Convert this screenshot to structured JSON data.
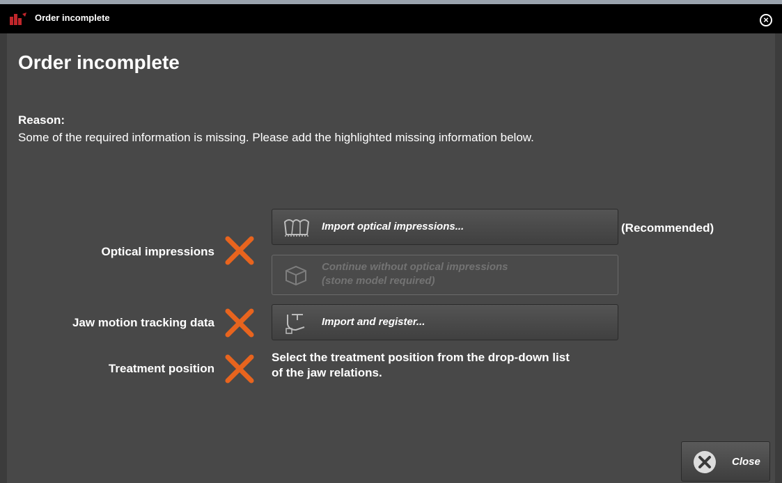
{
  "window": {
    "title": "Order incomplete",
    "close_icon": "circle-x-icon"
  },
  "dialog": {
    "heading": "Order incomplete",
    "reason_label": "Reason:",
    "reason_text": "Some of the required information is missing. Please add the highlighted missing information below."
  },
  "rows": {
    "optical": {
      "label": "Optical impressions",
      "status_icon": "missing-x-icon",
      "import_button": "Import optical impressions...",
      "recommended": "(Recommended)",
      "continue_button_line1": "Continue without optical impressions",
      "continue_button_line2": "(stone model required)"
    },
    "jaw": {
      "label": "Jaw motion tracking data",
      "status_icon": "missing-x-icon",
      "import_button": "Import and register..."
    },
    "treatment": {
      "label": "Treatment position",
      "status_icon": "missing-x-icon",
      "instruction_line1": "Select the treatment position from the drop-down list",
      "instruction_line2": "of the jaw relations."
    }
  },
  "footer": {
    "close_button": "Close"
  },
  "colors": {
    "accent": "#e8641e",
    "background": "#484848",
    "titlebar": "#000000"
  }
}
